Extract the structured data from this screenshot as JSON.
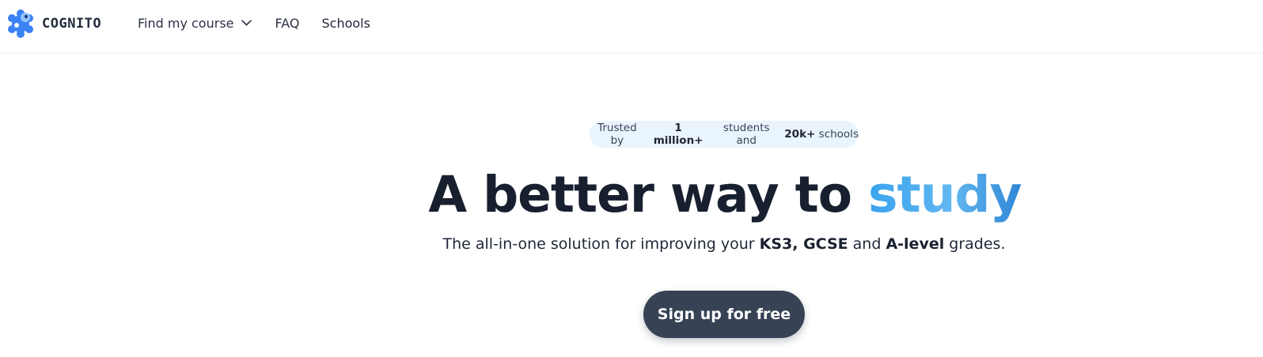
{
  "header": {
    "brand": "COGNITO",
    "brand_colors": {
      "logo_primary": "#3b82f6",
      "logo_light": "#93c5fd"
    },
    "nav": {
      "find_course": "Find my course",
      "faq": "FAQ",
      "schools": "Schools"
    }
  },
  "hero": {
    "trust_pill": {
      "prefix": "Trusted by ",
      "students_count": "1 million+",
      "middle": " students and ",
      "schools_count": "20k+",
      "suffix": " schools"
    },
    "headline": {
      "main": "A better way to ",
      "accent": "study"
    },
    "subline": {
      "prefix": "The all-in-one solution for improving your ",
      "levels_a": "KS3, GCSE",
      "middle": " and ",
      "levels_b": "A-level",
      "suffix": " grades."
    },
    "cta_label": "Sign up for free",
    "colors": {
      "accent_gradient_start": "#3aa3ee",
      "accent_gradient_end": "#2f86d6",
      "cta_background": "#374255",
      "pill_background": "#eaf4fd"
    }
  }
}
